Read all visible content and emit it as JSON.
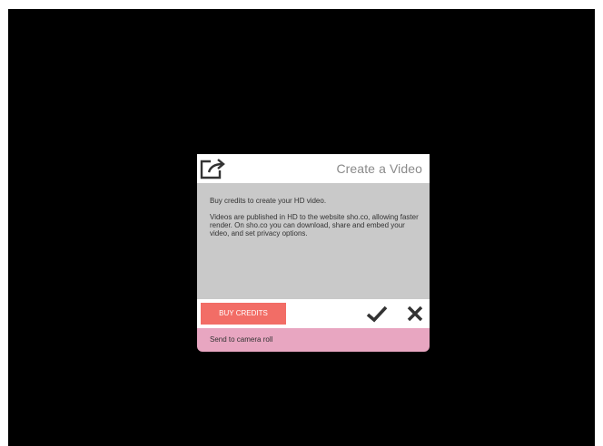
{
  "dialog": {
    "title": "Create a Video",
    "header_icon": "share-export-icon",
    "body": {
      "paragraph1": "Buy credits to create your HD video.",
      "paragraph2": "Videos are published in HD to the website sho.co, allowing faster render. On sho.co you can download, share and embed your video, and set privacy options."
    },
    "actions": {
      "buy_credits_label": "BUY CREDITS",
      "confirm_icon": "checkmark-icon",
      "cancel_icon": "close-icon"
    },
    "camera_roll_label": "Send to camera roll"
  },
  "colors": {
    "screen_background": "#000000",
    "header_background": "#ffffff",
    "body_background": "#c9c9c9",
    "buy_button": "#f2665e",
    "camera_roll_row": "#e8a6c1",
    "title_text": "#8a8a8a",
    "icon": "#333333"
  }
}
